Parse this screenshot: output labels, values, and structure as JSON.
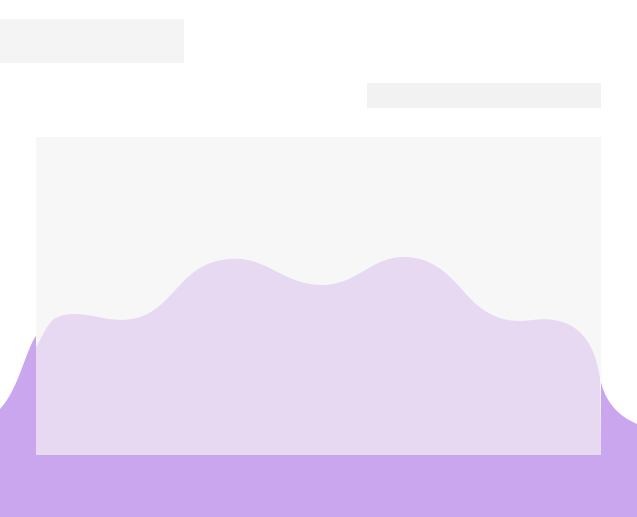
{
  "placeholders": {
    "title": "",
    "subtitle": ""
  },
  "colors": {
    "background": "#ffffff",
    "skeleton": "#f3f3f3",
    "panel": "#f7f7f7",
    "wave_back": "#c9a6ee",
    "wave_front": "#e6d9f1"
  },
  "decor": {
    "icon": "wave-illustration-icon"
  }
}
